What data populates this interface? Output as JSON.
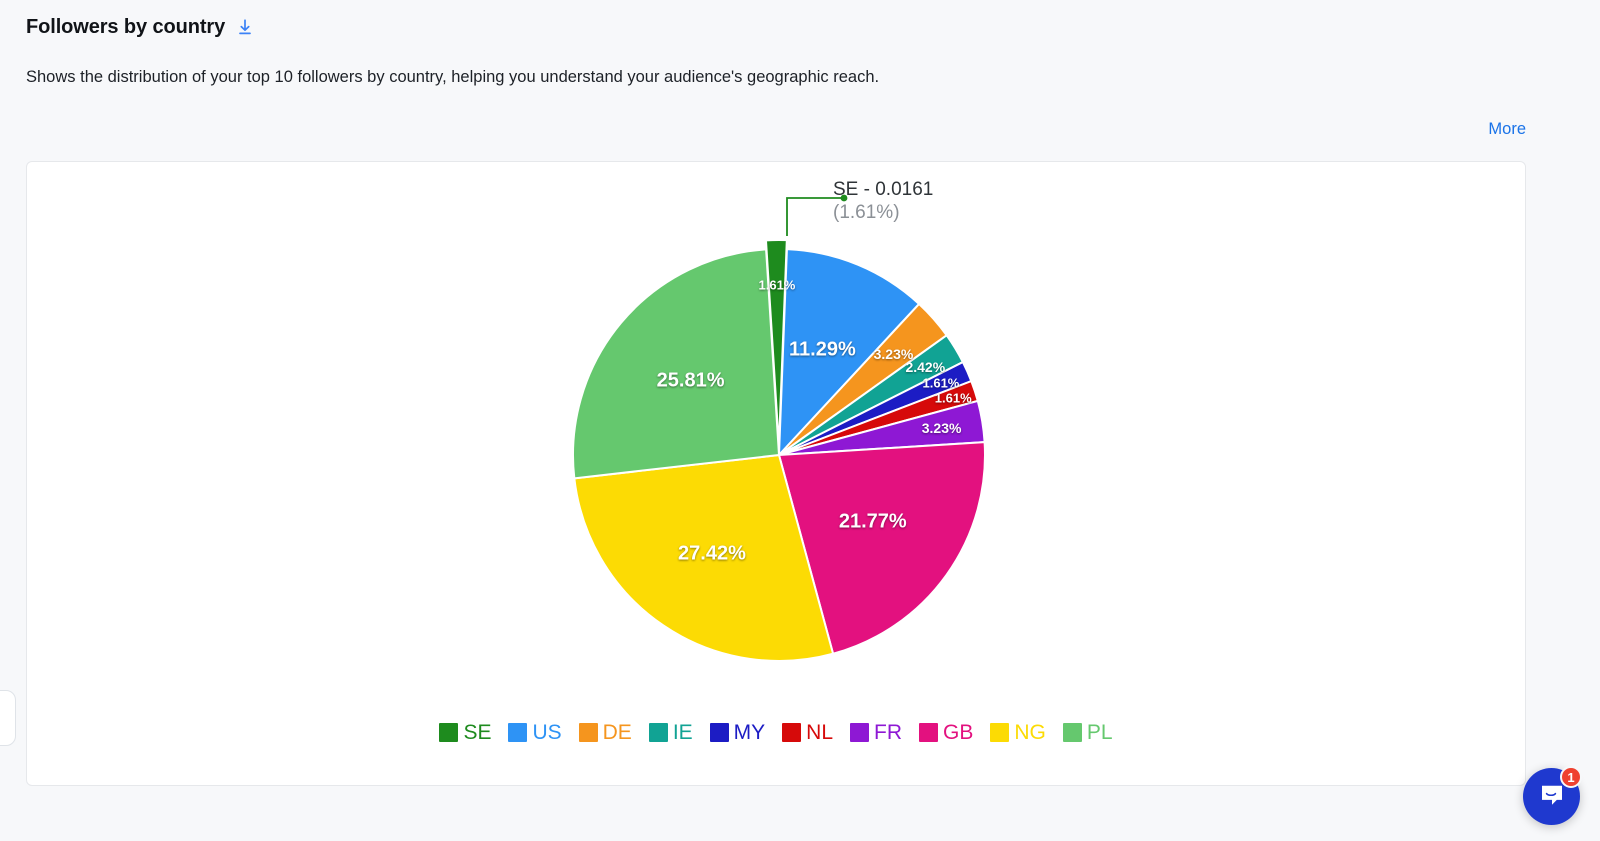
{
  "panel": {
    "title": "Followers by country",
    "download_icon": "download-icon",
    "subtitle": "Shows the distribution of your top 10 followers by country, helping you understand your audience's geographic reach.",
    "more_label": "More"
  },
  "callout": {
    "main": "SE - 0.0161",
    "sub": "(1.61%)"
  },
  "chat": {
    "icon": "intercom-messenger-icon",
    "badge_count": "1"
  },
  "chart_data": {
    "type": "pie",
    "title": "Followers by country",
    "subtitle": "Shows the distribution of your top 10 followers by country, helping you understand your audience's geographic reach.",
    "legend_position": "bottom",
    "value_unit": "percent",
    "categories": [
      "SE",
      "US",
      "DE",
      "IE",
      "MY",
      "NL",
      "FR",
      "GB",
      "NG",
      "PL"
    ],
    "values": [
      1.61,
      11.29,
      3.23,
      2.42,
      1.61,
      1.61,
      3.23,
      21.77,
      27.42,
      25.81
    ],
    "labels": [
      "1.61%",
      "11.29%",
      "3.23%",
      "2.42%",
      "1.61%",
      "1.61%",
      "3.23%",
      "21.77%",
      "27.42%",
      "25.81%"
    ],
    "colors": [
      "#1e8b1e",
      "#2e93f5",
      "#f5951e",
      "#11a394",
      "#1c1cc4",
      "#d60a0a",
      "#8e18d4",
      "#e3117f",
      "#fcdb04",
      "#65c86e"
    ],
    "exploded": [
      "SE"
    ],
    "annotations": [
      {
        "label": "SE - 0.0161",
        "sublabel": "(1.61%)",
        "target": "SE"
      }
    ],
    "legend": [
      {
        "label": "SE",
        "color": "#1e8b1e"
      },
      {
        "label": "US",
        "color": "#2e93f5"
      },
      {
        "label": "DE",
        "color": "#f5951e"
      },
      {
        "label": "IE",
        "color": "#11a394"
      },
      {
        "label": "MY",
        "color": "#1c1cc4"
      },
      {
        "label": "NL",
        "color": "#d60a0a"
      },
      {
        "label": "FR",
        "color": "#8e18d4"
      },
      {
        "label": "GB",
        "color": "#e3117f"
      },
      {
        "label": "NG",
        "color": "#fcdb04"
      },
      {
        "label": "PL",
        "color": "#65c86e"
      }
    ]
  }
}
